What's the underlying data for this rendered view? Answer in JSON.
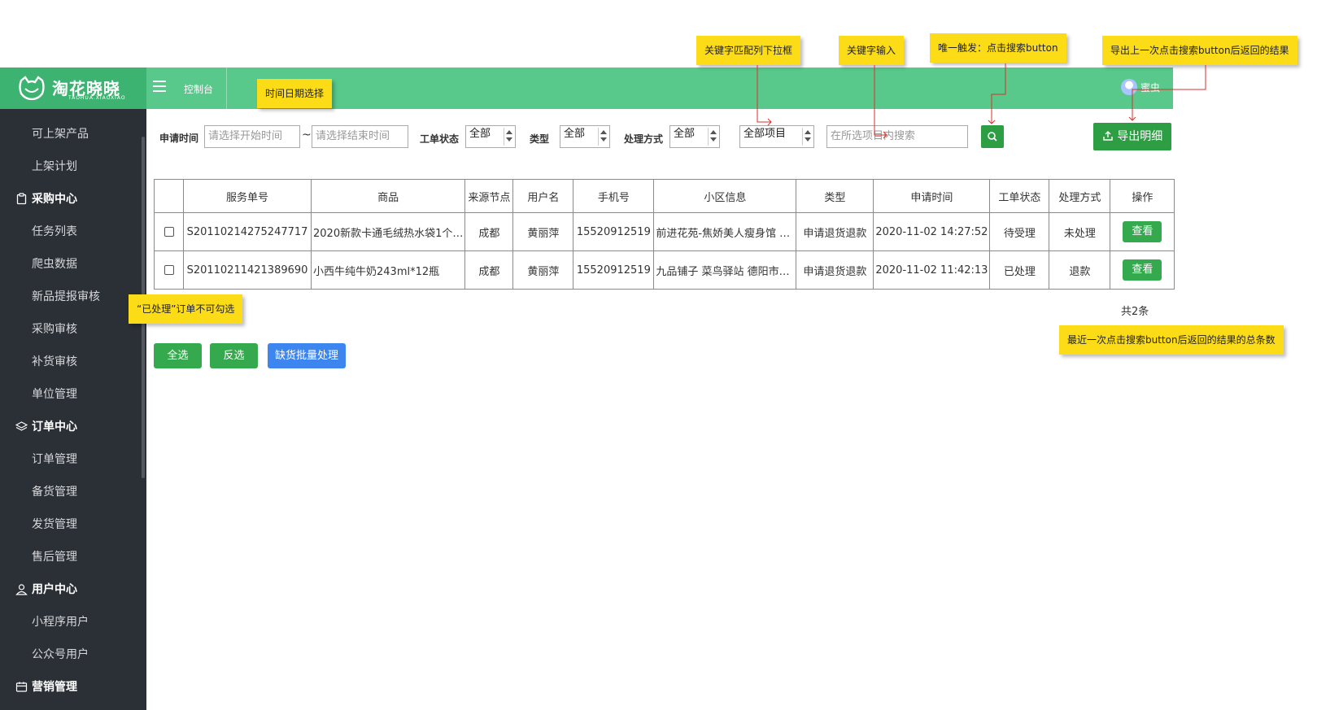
{
  "app": {
    "logo_cn": "淘花晓晓",
    "logo_en": "TAOHUA.XIAOXIAO",
    "console_label": "控制台",
    "user_name": "蜜虫",
    "brand_color": "#3cb371",
    "header_color": "#58c98a"
  },
  "sidebar": {
    "items": [
      {
        "label": "可上架产品",
        "kind": "sub"
      },
      {
        "label": "上架计划",
        "kind": "sub"
      },
      {
        "label": "采购中心",
        "kind": "group",
        "icon": "clipboard-icon"
      },
      {
        "label": "任务列表",
        "kind": "sub"
      },
      {
        "label": "爬虫数据",
        "kind": "sub"
      },
      {
        "label": "新品提报审核",
        "kind": "sub"
      },
      {
        "label": "采购审核",
        "kind": "sub"
      },
      {
        "label": "补货审核",
        "kind": "sub"
      },
      {
        "label": "单位管理",
        "kind": "sub"
      },
      {
        "label": "订单中心",
        "kind": "group",
        "icon": "layers-icon"
      },
      {
        "label": "订单管理",
        "kind": "sub"
      },
      {
        "label": "备货管理",
        "kind": "sub"
      },
      {
        "label": "发货管理",
        "kind": "sub"
      },
      {
        "label": "售后管理",
        "kind": "sub"
      },
      {
        "label": "用户中心",
        "kind": "group",
        "icon": "user-icon"
      },
      {
        "label": "小程序用户",
        "kind": "sub"
      },
      {
        "label": "公众号用户",
        "kind": "sub"
      },
      {
        "label": "营销管理",
        "kind": "group",
        "icon": "calendar-icon"
      }
    ]
  },
  "filters": {
    "apply_time_label": "申请时间",
    "start_placeholder": "请选择开始时间",
    "tilde": "~",
    "end_placeholder": "请选择结束时间",
    "status_label": "工单状态",
    "status_value": "全部",
    "type_label": "类型",
    "type_value": "全部",
    "handle_label": "处理方式",
    "handle_value": "全部",
    "keyword_field_value": "全部项目",
    "keyword_placeholder": "在所选项目内搜索",
    "export_label": "导出明细"
  },
  "table": {
    "columns": [
      "",
      "服务单号",
      "商品",
      "来源节点",
      "用户名",
      "手机号",
      "小区信息",
      "类型",
      "申请时间",
      "工单状态",
      "处理方式",
      "操作"
    ],
    "rows": [
      {
        "service_no": "S20110214275247717",
        "product": "2020新款卡通毛绒热水袋1个…",
        "source": "成都",
        "user": "黄丽萍",
        "phone": "15520912519",
        "community": "前进花苑-焦娇美人瘦身馆 …",
        "type": "申请退货退款",
        "time": "2020-11-02 14:27:52",
        "status": "待受理",
        "handling": "未处理",
        "action": "查看"
      },
      {
        "service_no": "S20110211421389690",
        "product": "小西牛纯牛奶243ml*12瓶",
        "source": "成都",
        "user": "黄丽萍",
        "phone": "15520912519",
        "community": "九品铺子 菜鸟驿站 德阳市…",
        "type": "申请退货退款",
        "time": "2020-11-02 11:42:13",
        "status": "已处理",
        "handling": "退款",
        "action": "查看"
      }
    ]
  },
  "total_text": "共2条",
  "actions": {
    "select_all": "全选",
    "invert": "反选",
    "batch": "缺货批量处理"
  },
  "notes": {
    "date_select": "时间日期选择",
    "keyword_dropdown": "关键字匹配列下拉框",
    "keyword_input": "关键字输入",
    "only_trigger": "唯一触发：点击搜索button",
    "export_result": "导出上一次点击搜索button后返回的结果",
    "processed_not_selectable": "“已处理”订单不可勾选",
    "total_count": "最近一次点击搜索button后返回的结果的总条数"
  },
  "colors": {
    "sidebar_bg": "#2b2f36",
    "green_button": "#2e9e45",
    "blue_button": "#3d86f0",
    "note_yellow": "#fbdc16",
    "arrow_red": "#d9302c"
  }
}
